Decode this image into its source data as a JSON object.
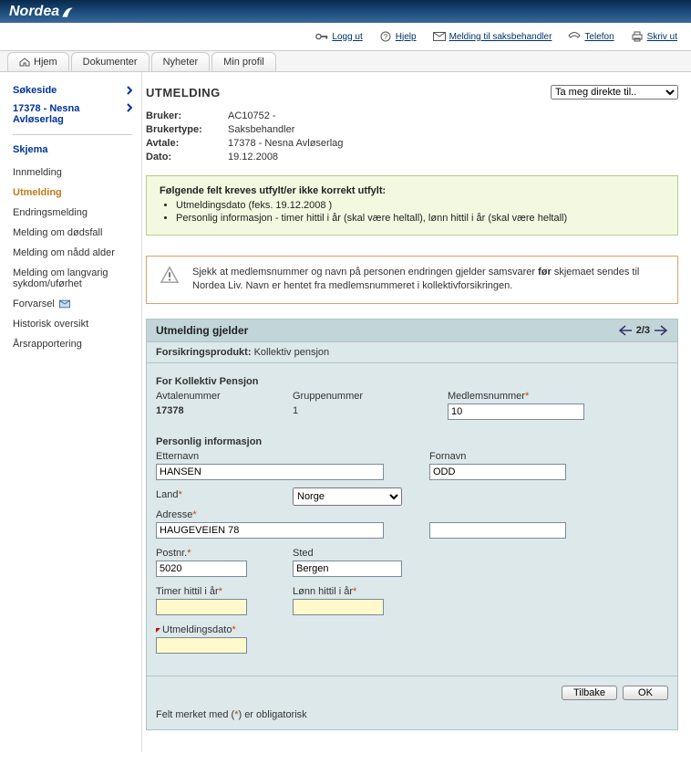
{
  "brand": "Nordea",
  "toolbar": {
    "logout": "Logg ut",
    "help": "Hjelp",
    "message": "Melding til saksbehandler",
    "phone": "Telefon",
    "print": "Skriv ut"
  },
  "tabs": {
    "home": "Hjem",
    "documents": "Dokumenter",
    "news": "Nyheter",
    "profile": "Min profil"
  },
  "sidebar": {
    "search": "Søkeside",
    "context": "17378 - Nesna Avløserlag",
    "section": "Skjema",
    "items": [
      {
        "label": "Innmelding"
      },
      {
        "label": "Utmelding",
        "active": true
      },
      {
        "label": "Endringsmelding"
      },
      {
        "label": "Melding om dødsfall"
      },
      {
        "label": "Melding om nådd alder"
      },
      {
        "label": "Melding om langvarig sykdom/uførhet"
      },
      {
        "label": "Forvarsel",
        "icon": true
      },
      {
        "label": "Historisk oversikt"
      },
      {
        "label": "Årsrapportering"
      }
    ]
  },
  "page": {
    "title": "UTMELDING",
    "directlink_placeholder": "Ta meg direkte til..",
    "meta": {
      "user_label": "Bruker:",
      "user_value": "AC10752 -",
      "usertype_label": "Brukertype:",
      "usertype_value": "Saksbehandler",
      "contract_label": "Avtale:",
      "contract_value": "17378 - Nesna Avløserlag",
      "date_label": "Dato:",
      "date_value": "19.12.2008"
    }
  },
  "validation": {
    "head": "Følgende felt kreves utfylt/er ikke korrekt utfylt:",
    "items": [
      "Utmeldingsdato (feks. 19.12.2008 )",
      "Personlig informasjon - timer hittil i år (skal være heltall), lønn hittil i år (skal være heltall)"
    ]
  },
  "info": {
    "pre": "Sjekk at medlemsnummer og navn på personen endringen gjelder samsvarer ",
    "bold": "før",
    "post": " skjemaet sendes til Nordea Liv. Navn er hentet fra medlemsnummeret i kollektivforsikringen."
  },
  "section": {
    "title": "Utmelding gjelder",
    "pager": "2/3",
    "product_label": "Forsikringsprodukt:",
    "product_value": "Kollektiv pensjon",
    "group1": {
      "title": "For Kollektiv Pensjon",
      "contractno_label": "Avtalenummer",
      "contractno_value": "17378",
      "groupno_label": "Gruppenummer",
      "groupno_value": "1",
      "memberno_label": "Medlemsnummer",
      "memberno_value": "10"
    },
    "personal": {
      "title": "Personlig informasjon",
      "lastname_label": "Etternavn",
      "lastname_value": "HANSEN",
      "firstname_label": "Fornavn",
      "firstname_value": "ODD",
      "country_label": "Land",
      "country_value": "Norge",
      "address_label": "Adresse",
      "address_value": "HAUGEVEIEN 78",
      "address2_value": "",
      "postno_label": "Postnr.",
      "postno_value": "5020",
      "city_label": "Sted",
      "city_value": "Bergen",
      "hours_label": "Timer hittil i år",
      "hours_value": "",
      "pay_label": "Lønn hittil i år",
      "pay_value": "",
      "outdate_label": "Utmeldingsdato",
      "outdate_value": ""
    },
    "buttons": {
      "back": "Tilbake",
      "ok": "OK"
    },
    "footnote_pre": "Felt merket med (",
    "footnote_mid": "*",
    "footnote_post": ") er obligatorisk"
  }
}
